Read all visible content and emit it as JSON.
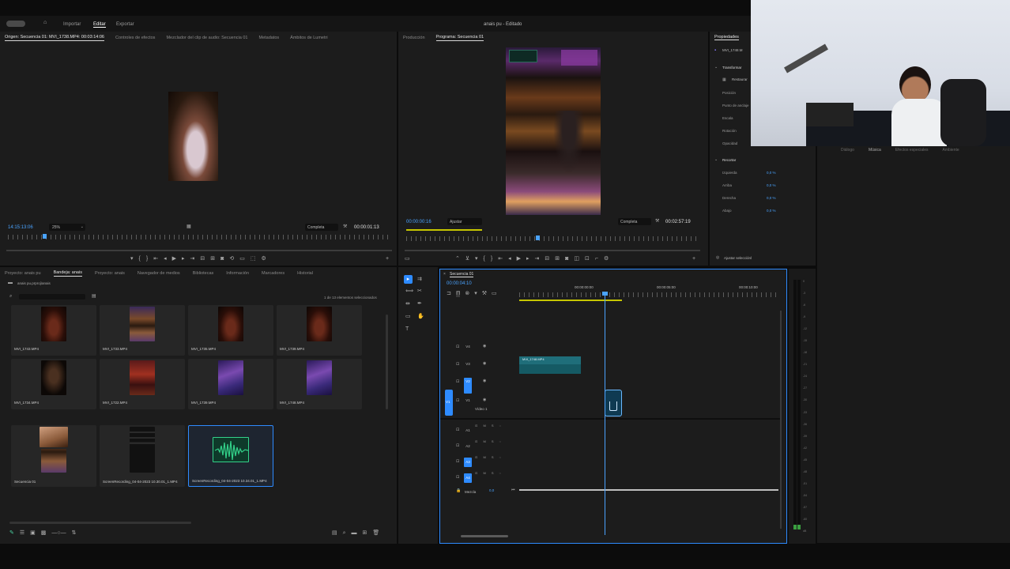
{
  "app": {
    "title": "anais pu - Editado",
    "workspaces": [
      "Importar",
      "Editar",
      "Exportar"
    ],
    "active_workspace": "Editar"
  },
  "source_monitor": {
    "tabs": [
      "Origen: Secuencia 01: MVI_1738.MP4: 00:03:14:06",
      "Controles de efectos",
      "Mezclador del clip de audio: Secuencia 01",
      "Metadatos",
      "Ámbitos de Lumetri"
    ],
    "timecode": "14:15:13:06",
    "zoom": "25%",
    "quality": "Completa",
    "duration": "00:00:01:13",
    "playhead_fraction": 0.09
  },
  "program_monitor": {
    "tabs": [
      "Producción",
      "Programa: Secuencia 01"
    ],
    "timecode": "00:00:00:16",
    "fit": "Ajustar",
    "quality": "Completa",
    "duration": "00:02:57:19",
    "playhead_fraction": 0.44
  },
  "properties": {
    "title": "Propiedades",
    "clip": "MVI_1748.M",
    "sections": {
      "transform": "Transformar",
      "reset": "Restaurar",
      "rows": [
        "Posición",
        "Punto de anclaje",
        "Escala",
        "Rotación",
        "Opacidad"
      ],
      "crop": "Recortar",
      "crop_rows": [
        {
          "label": "Izquierda",
          "value": "0,0 %"
        },
        {
          "label": "Arriba",
          "value": "0,0 %"
        },
        {
          "label": "Derecha",
          "value": "0,0 %"
        },
        {
          "label": "Abajo",
          "value": "0,0 %"
        }
      ]
    },
    "fit_button": "Ajustar selecciónl"
  },
  "right_tabs": [
    "Diálogo",
    "Música",
    "Efectos especiales",
    "Ambiente"
  ],
  "project": {
    "tabs": [
      "Proyecto: anais pu",
      "Bandeja: anais",
      "Proyecto: anais",
      "Navegador de medios",
      "Bibliotecas",
      "Información",
      "Marcadores",
      "Historial"
    ],
    "path": "anais pu.prproj\\anais",
    "selection_info": "1 de 13 elementos seleccionados",
    "items": [
      {
        "name": "MVI_1743.MP4",
        "art": "dark-red"
      },
      {
        "name": "MVI_1733.MP4",
        "art": "bar"
      },
      {
        "name": "MVI_1735.MP4",
        "art": "dark-red"
      },
      {
        "name": "MVI_1739.MP4",
        "art": "dark-red"
      },
      {
        "name": "MVI_1734.MP4",
        "art": "dark"
      },
      {
        "name": "MVI_1722.MP4",
        "art": "red"
      },
      {
        "name": "MVI_1739.MP4",
        "art": "purple"
      },
      {
        "name": "MVI_1748.MP4",
        "art": "purple"
      },
      {
        "name": "Secuencia 01",
        "art": "bar"
      },
      {
        "name": "ScreenRecording_04-04-2023 10.30.01_1.MP4",
        "art": "phone"
      },
      {
        "name": "ScreenRecording_04-04-2023 10.34.01_1.MP4",
        "art": "audio"
      },
      {
        "name": "",
        "art": "skin"
      }
    ]
  },
  "timeline": {
    "tab": "Secuencia 01",
    "timecode": "00:00:04:10",
    "ruler_labels": [
      "00:00:00:00",
      "00:00:05:00",
      "00:00:10:00"
    ],
    "video_tracks": [
      {
        "id": "V4",
        "name": ""
      },
      {
        "id": "V3",
        "name": ""
      },
      {
        "id": "V2",
        "name": ""
      },
      {
        "id": "V1",
        "name": "Vídeo 1"
      }
    ],
    "audio_tracks": [
      {
        "id": "A1",
        "name": ""
      },
      {
        "id": "A2",
        "name": ""
      },
      {
        "id": "A3",
        "name": ""
      },
      {
        "id": "A4",
        "name": ""
      }
    ],
    "source_patch_v": "V1",
    "mix_label": "Mezcla",
    "mix_value": "0,0",
    "clip_name": "MVI_1748.MP4",
    "playhead_fraction": 0.33
  },
  "meter_labels": [
    "0",
    "-3",
    "-6",
    "-9",
    "-12",
    "-15",
    "-18",
    "-21",
    "-24",
    "-27",
    "-30",
    "-33",
    "-36",
    "-39",
    "-42",
    "-45",
    "-48",
    "-51",
    "-54",
    "-57",
    "-60",
    "dB"
  ],
  "colors": {
    "accent": "#2e8bff",
    "panel": "#1c1c1c",
    "background": "#0c0c0c",
    "clip_teal": "#1f6e7a",
    "audio_green": "#33d28a"
  }
}
